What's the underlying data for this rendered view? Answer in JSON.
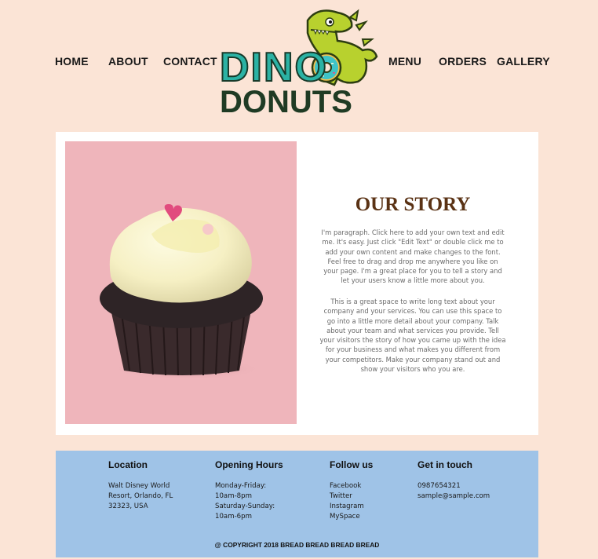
{
  "nav": {
    "left": [
      "HOME",
      "ABOUT",
      "CONTACT"
    ],
    "right": [
      "MENU",
      "ORDERS",
      "GALLERY"
    ]
  },
  "logo": {
    "line1": "DINO",
    "line2": "DONUTS"
  },
  "story": {
    "title": "OUR STORY",
    "paragraph1": "I'm paragraph. Click here to add your own text and edit me. It's easy. Just click \"Edit Text\" or double click me to add your own content and make changes to the font. Feel free to drag and drop me anywhere you like on your page. I'm a great place for you to tell a story and let your users know a little more about you.",
    "paragraph2": "This is a great space to write long text about your company and your services. You can use this space to go into a little more detail about your company. Talk about your team and what services you provide. Tell your visitors the story of how you came up with the idea for your business and what makes you different from your competitors. Make your company stand out and show your visitors who you are."
  },
  "footer": {
    "columns": [
      {
        "heading": "Location",
        "lines": [
          "Walt Disney World",
          "Resort, Orlando, FL",
          "32323, USA"
        ]
      },
      {
        "heading": "Opening Hours",
        "lines": [
          "Monday-Friday:",
          "10am-8pm",
          "Saturday-Sunday:",
          "10am-6pm"
        ]
      },
      {
        "heading": "Follow us",
        "lines": [
          "Facebook",
          "Twitter",
          "Instagram",
          "MySpace"
        ]
      },
      {
        "heading": "Get in touch",
        "lines": [
          "0987654321",
          "sample@sample.com"
        ]
      }
    ],
    "copyright": "@ COPYRIGHT 2018 BREAD BREAD BREAD BREAD"
  },
  "colors": {
    "page_bg": "#fbe4d6",
    "footer_bg": "#9fc3e7",
    "title": "#5a3214",
    "photo_bg": "#efb5bb",
    "logo_teal": "#2bb2a4",
    "logo_dark": "#1f3b24"
  },
  "icons": [
    "dino-mascot-logo",
    "cupcake-photo"
  ]
}
